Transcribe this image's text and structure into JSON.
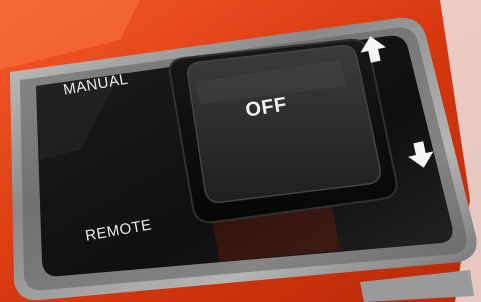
{
  "labels": {
    "manual": "MANUAL",
    "remote": "REMOTE",
    "switch_state": "OFF"
  },
  "icons": {
    "up": "arrow-up-icon",
    "down": "arrow-down-icon"
  },
  "colors": {
    "housing": "#e8431b",
    "panel": "#141414",
    "rocker": "#2b2b2b",
    "bezel": "#8f8f8f",
    "label_text": "#ededed"
  }
}
